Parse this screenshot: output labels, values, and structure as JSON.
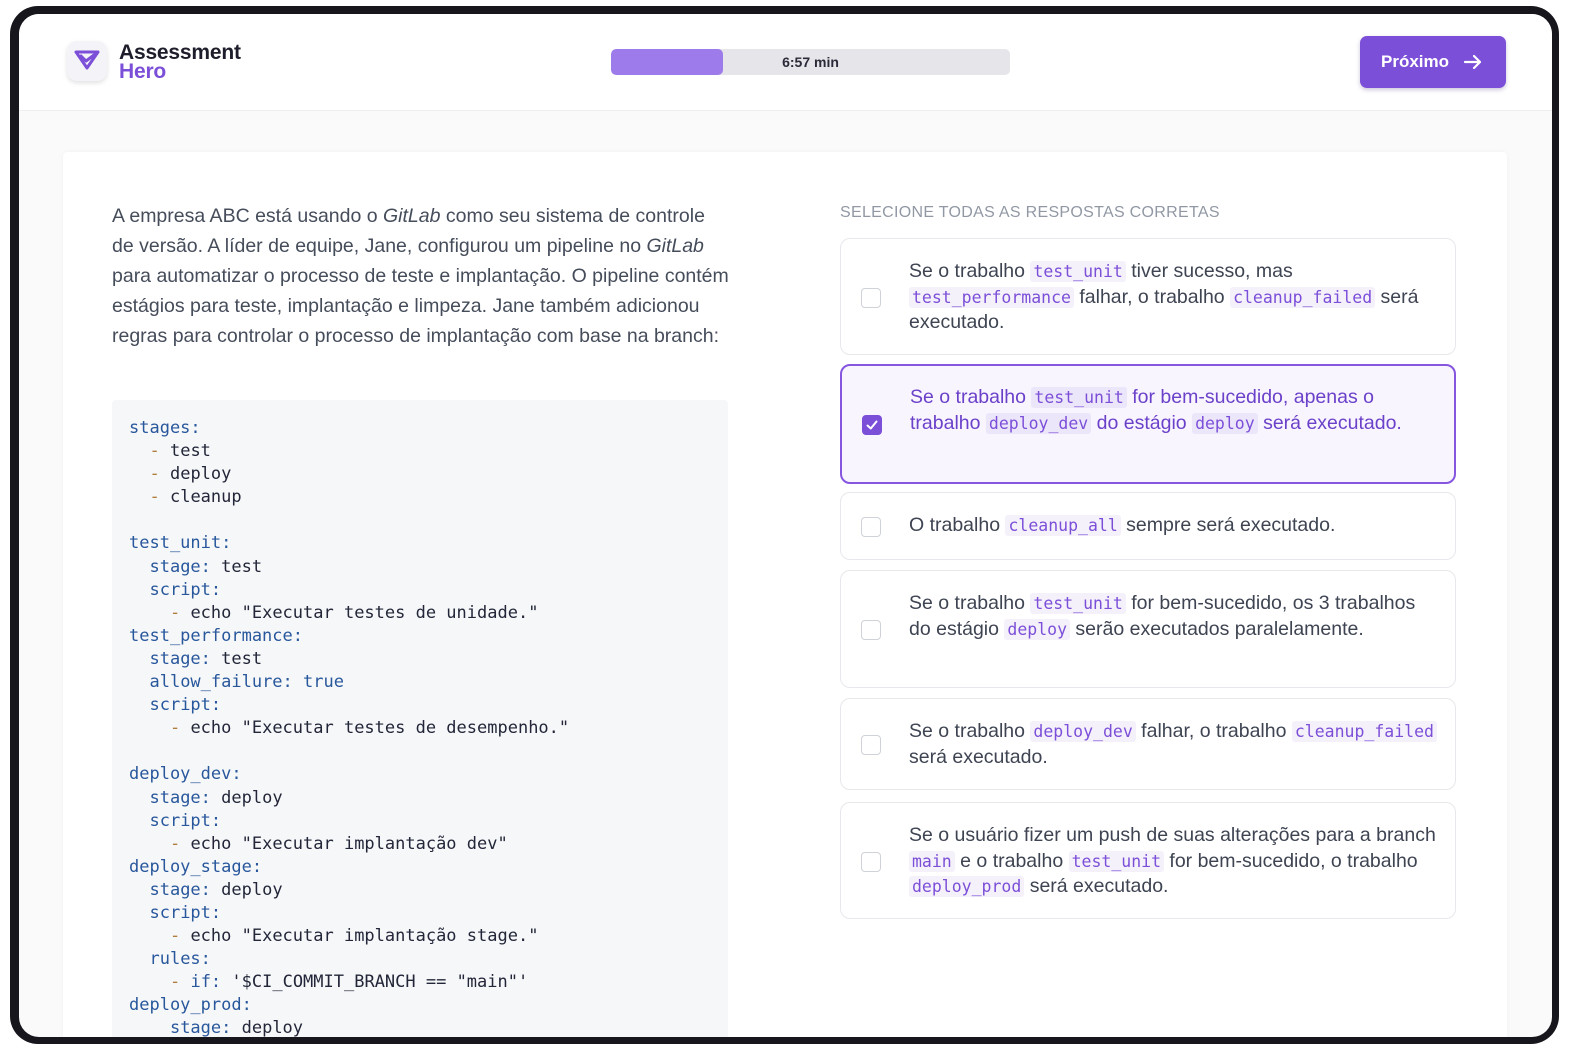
{
  "app": {
    "brand_line1": "Assessment",
    "brand_line2": "Hero",
    "accent_color": "#7c4fd8",
    "logo_icon": "heart-check-icon"
  },
  "timer": {
    "label": "6:57 min",
    "progress_fraction": 0.28
  },
  "toolbar": {
    "next_label": "Próximo",
    "next_icon": "arrow-right-icon"
  },
  "question": {
    "parts": [
      "A empresa ABC está usando o ",
      "GitLab",
      " como seu sistema de controle de versão. A líder de equipe, Jane, configurou um pipeline no ",
      "GitLab",
      " para automatizar o processo de teste e implantação. O pipeline contém estágios para teste, implantação e limpeza. Jane também adicionou regras para controlar o processo de implantação com base na branch:"
    ],
    "code_lines": [
      "stages:",
      "  - test",
      "  - deploy",
      "  - cleanup",
      "",
      "test_unit:",
      "  stage: test",
      "  script:",
      "    - echo \"Executar testes de unidade.\"",
      "test_performance:",
      "  stage: test",
      "  allow_failure: true",
      "  script:",
      "    - echo \"Executar testes de desempenho.\"",
      "",
      "deploy_dev:",
      "  stage: deploy",
      "  script:",
      "    - echo \"Executar implantação dev\"",
      "deploy_stage:",
      "  stage: deploy",
      "  script:",
      "    - echo \"Executar implantação stage.\"",
      "  rules:",
      "    - if: '$CI_COMMIT_BRANCH == \"main\"'",
      "deploy_prod:",
      "    stage: deploy"
    ]
  },
  "answers": {
    "instruction": "SELECIONE TODAS AS RESPOSTAS CORRETAS",
    "options": [
      {
        "checked": false,
        "segments": [
          {
            "t": "Se o trabalho "
          },
          {
            "c": "test_unit"
          },
          {
            "t": " tiver sucesso, mas "
          },
          {
            "c": "test_performance"
          },
          {
            "t": " falhar, o trabalho "
          },
          {
            "c": "cleanup_failed"
          },
          {
            "t": " será executado."
          }
        ]
      },
      {
        "checked": true,
        "segments": [
          {
            "t": "Se o trabalho "
          },
          {
            "c": "test_unit"
          },
          {
            "t": " for bem-sucedido, apenas o trabalho "
          },
          {
            "c": "deploy_dev"
          },
          {
            "t": " do estágio "
          },
          {
            "c": "deploy"
          },
          {
            "t": " será executado."
          }
        ]
      },
      {
        "checked": false,
        "segments": [
          {
            "t": "O trabalho "
          },
          {
            "c": "cleanup_all"
          },
          {
            "t": " sempre será executado."
          }
        ]
      },
      {
        "checked": false,
        "segments": [
          {
            "t": "Se o trabalho "
          },
          {
            "c": "test_unit"
          },
          {
            "t": " for bem-sucedido, os 3 trabalhos do estágio "
          },
          {
            "c": "deploy"
          },
          {
            "t": " serão executados paralelamente."
          }
        ]
      },
      {
        "checked": false,
        "segments": [
          {
            "t": "Se o trabalho "
          },
          {
            "c": "deploy_dev"
          },
          {
            "t": " falhar, o trabalho "
          },
          {
            "c": "cleanup_failed"
          },
          {
            "t": " será executado."
          }
        ]
      },
      {
        "checked": false,
        "segments": [
          {
            "t": "Se o usuário fizer um push de suas alterações para a branch "
          },
          {
            "c": "main"
          },
          {
            "t": " e o trabalho "
          },
          {
            "c": "test_unit"
          },
          {
            "t": " for bem-sucedido, o trabalho "
          },
          {
            "c": "deploy_prod"
          },
          {
            "t": " será executado."
          }
        ]
      }
    ]
  }
}
